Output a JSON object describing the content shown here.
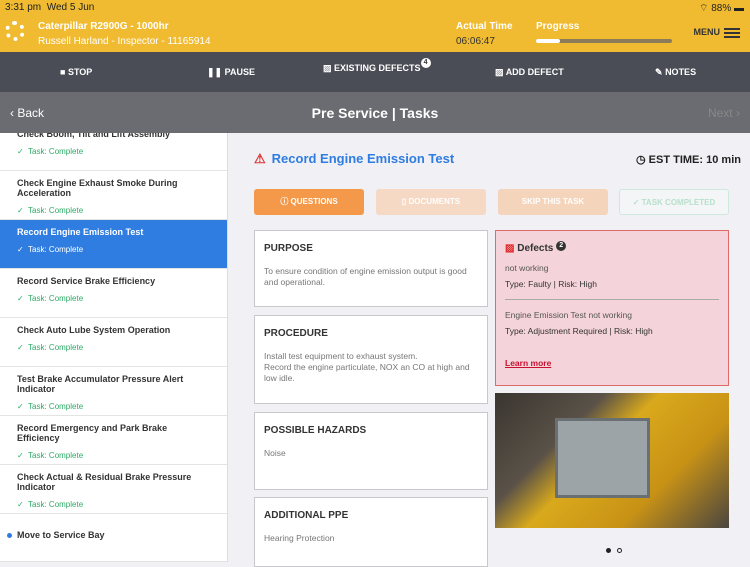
{
  "status": {
    "time": "3:31 pm",
    "date": "Wed 5 Jun",
    "battery": "88%"
  },
  "header": {
    "machine": "Caterpillar R2900G - 1000hr",
    "inspector": "Russell Harland - Inspector - 11165914",
    "actual_time_label": "Actual Time",
    "actual_time": "06:06:47",
    "progress_label": "Progress",
    "progress": 0.18,
    "menu": "MENU"
  },
  "toolbar": {
    "stop": "STOP",
    "pause": "PAUSE",
    "existing_defects": "EXISTING DEFECTS",
    "existing_defects_count": "4",
    "add_defect": "ADD DEFECT",
    "notes": "NOTES"
  },
  "nav": {
    "back": "Back",
    "title": "Pre Service | Tasks",
    "next": "Next"
  },
  "tasks": [
    {
      "name": "Check Boom, Tilt and Lift Assembly",
      "status": "Task: Complete"
    },
    {
      "name": "Check Engine Exhaust Smoke During Acceleration",
      "status": "Task: Complete"
    },
    {
      "name": "Record Engine Emission Test",
      "status": "Task: Complete"
    },
    {
      "name": "Record Service Brake Efficiency",
      "status": "Task: Complete"
    },
    {
      "name": "Check Auto Lube System Operation",
      "status": "Task: Complete"
    },
    {
      "name": "Test Brake Accumulator Pressure Alert Indicator",
      "status": "Task: Complete"
    },
    {
      "name": "Record Emergency and Park Brake Efficiency",
      "status": "Task: Complete"
    },
    {
      "name": "Check Actual & Residual Brake Pressure Indicator",
      "status": "Task: Complete"
    }
  ],
  "move": "Move to Service Bay",
  "task": {
    "title": "Record Engine Emission Test",
    "est": "EST TIME: 10 min"
  },
  "buttons": {
    "questions": "QUESTIONS",
    "documents": "DOCUMENTS",
    "skip": "SKIP THIS TASK",
    "completed": "TASK COMPLETED"
  },
  "cards": {
    "purpose_h": "PURPOSE",
    "purpose": "To ensure condition of engine emission output is good and operational.",
    "procedure_h": "PROCEDURE",
    "procedure1": "Install test equipment to exhaust system.",
    "procedure2": "Record the engine particulate, NOX an CO at high and low idle.",
    "hazards_h": "POSSIBLE HAZARDS",
    "hazards": "Noise",
    "ppe_h": "ADDITIONAL PPE",
    "ppe": "Hearing Protection"
  },
  "defects": {
    "title": "Defects",
    "count": "2",
    "items": [
      {
        "desc": "not working",
        "meta": "Type: Faulty | Risk: High"
      },
      {
        "desc": "Engine Emission Test not working",
        "meta": "Type: Adjustment Required | Risk: High"
      }
    ],
    "learn_more": "Learn more"
  },
  "colors": {
    "accent": "#2f7de1",
    "header": "#f0bb31",
    "orange": "#f4994a",
    "danger": "#d33"
  }
}
